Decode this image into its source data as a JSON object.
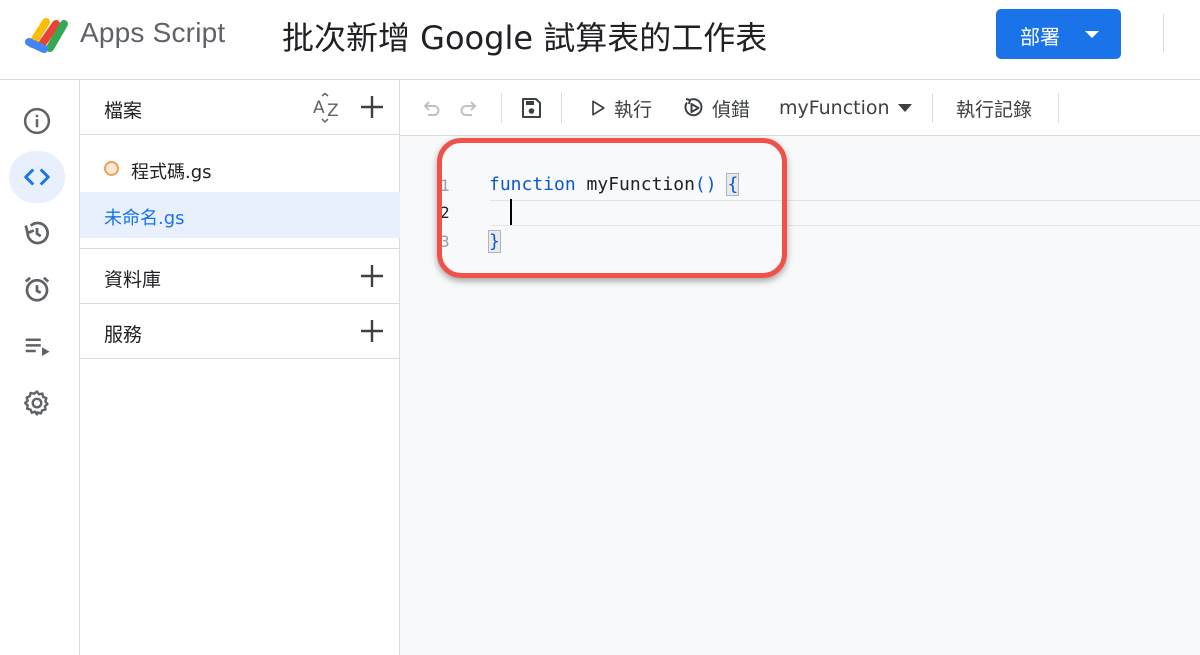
{
  "header": {
    "app_name": "Apps Script",
    "project_title": "批次新增 Google 試算表的工作表",
    "deploy_label": "部署"
  },
  "rail": {
    "items": [
      {
        "icon": "info-icon"
      },
      {
        "icon": "code-icon",
        "active": true
      },
      {
        "icon": "history-icon"
      },
      {
        "icon": "alarm-clock-icon"
      },
      {
        "icon": "playlist-play-icon"
      },
      {
        "icon": "gear-icon"
      }
    ]
  },
  "files_panel": {
    "files_title": "檔案",
    "files": [
      {
        "name": "程式碼.gs",
        "status": "modified"
      },
      {
        "name": "未命名.gs",
        "selected": true
      }
    ],
    "libraries_title": "資料庫",
    "services_title": "服務"
  },
  "toolbar": {
    "run_label": "執行",
    "debug_label": "偵錯",
    "function_name": "myFunction",
    "logs_label": "執行記錄"
  },
  "editor": {
    "line_numbers": [
      "1",
      "2",
      "3"
    ],
    "line1_keyword": "function",
    "line1_name": "myFunction",
    "line1_parens": "()",
    "line1_brace": "{",
    "line3_brace": "}"
  },
  "colors": {
    "accent": "#1a73e8",
    "highlight_border": "#f0524b",
    "keyword": "#0b57d0"
  }
}
